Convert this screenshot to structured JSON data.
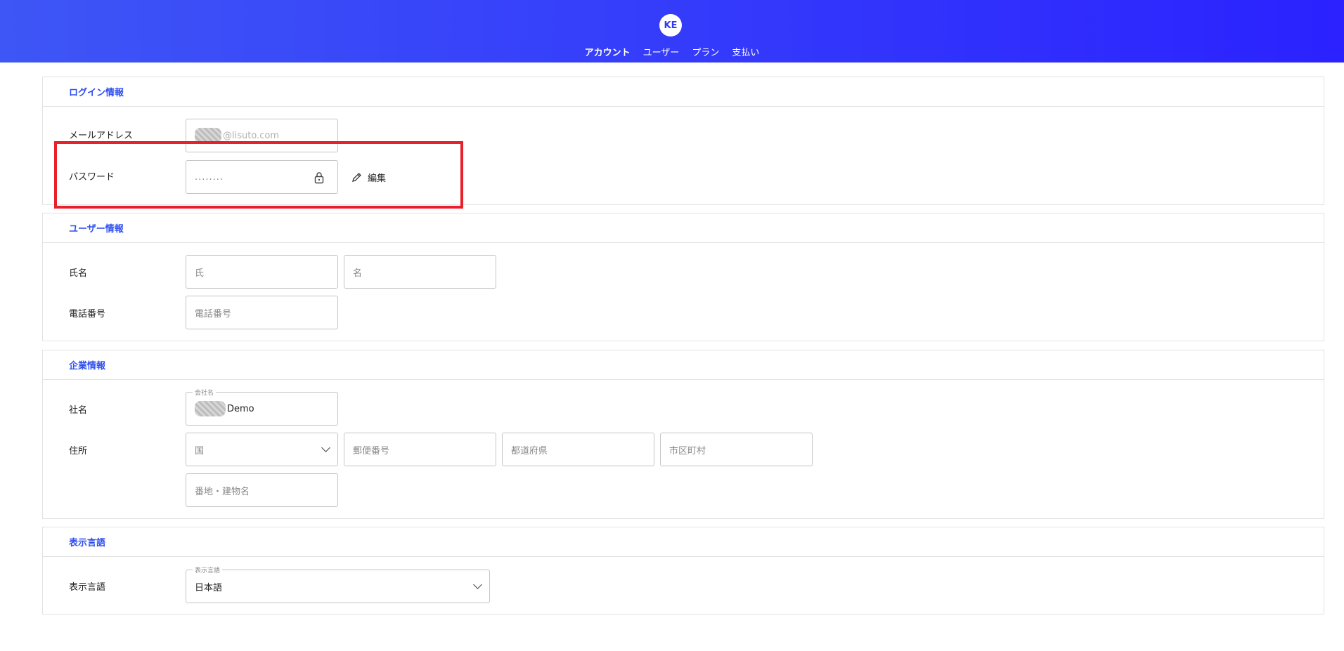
{
  "header": {
    "avatar": "KE",
    "nav": [
      "アカウント",
      "ユーザー",
      "プラン",
      "支払い"
    ]
  },
  "login": {
    "title": "ログイン情報",
    "email_label": "メールアドレス",
    "email_value": "@lisuto.com",
    "password_label": "パスワード",
    "password_value": "........",
    "edit_label": "編集"
  },
  "user": {
    "title": "ユーザー情報",
    "name_label": "氏名",
    "last_name_placeholder": "氏",
    "first_name_placeholder": "名",
    "phone_label": "電話番号",
    "phone_placeholder": "電話番号"
  },
  "company": {
    "title": "企業情報",
    "name_label": "社名",
    "name_float_label": "会社名",
    "name_value": "Demo",
    "address_label": "住所",
    "country_placeholder": "国",
    "zip_placeholder": "郵便番号",
    "prefecture_placeholder": "都道府県",
    "city_placeholder": "市区町村",
    "street_placeholder": "番地・建物名"
  },
  "language": {
    "title": "表示言語",
    "label": "表示言語",
    "float_label": "表示言語",
    "value": "日本語"
  },
  "colors": {
    "accent": "#2f4ef0",
    "header_start": "#3e56f6",
    "header_end": "#2b22ff",
    "highlight": "#e8202a"
  }
}
